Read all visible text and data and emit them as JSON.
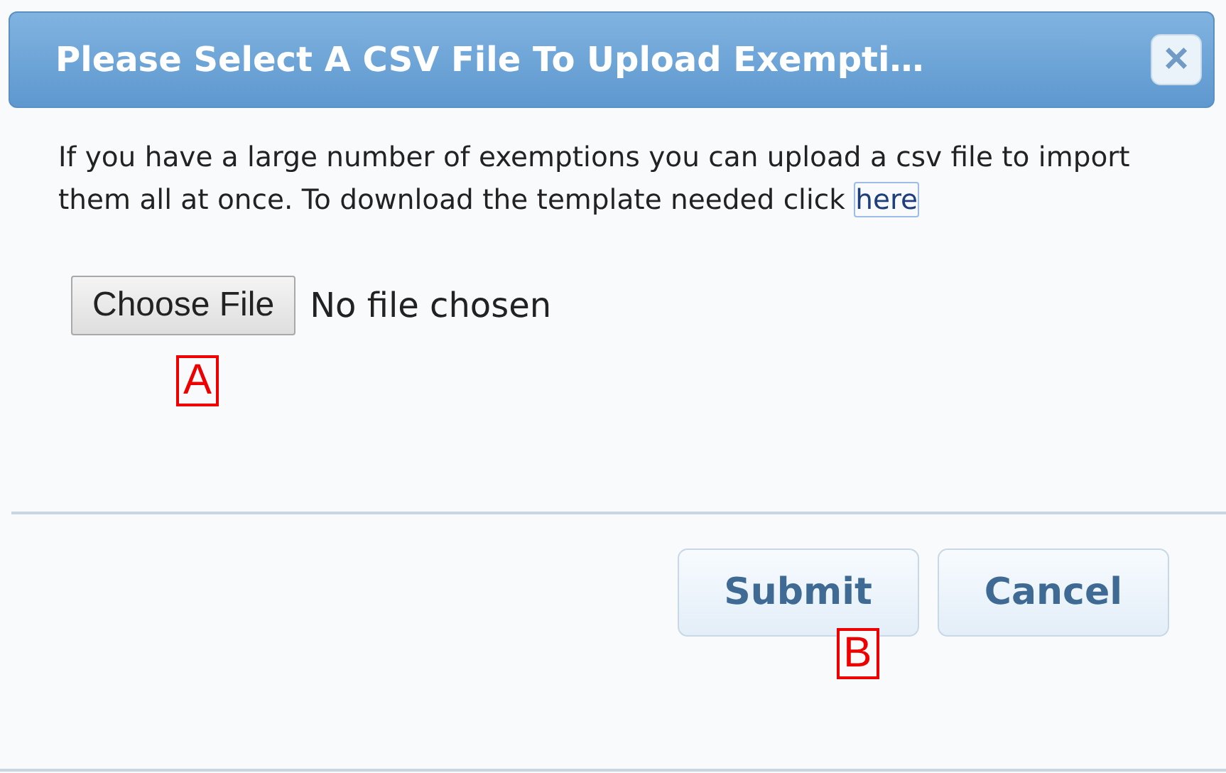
{
  "dialog": {
    "title": "Please Select A CSV File To Upload Exempti…",
    "close": "×"
  },
  "intro": {
    "text": "If you have a large number of exemptions you can upload a csv file to import them all at once. To download the template needed click ",
    "link": "here"
  },
  "file_input": {
    "button": "Choose File",
    "status": "No file chosen",
    "callout": "A"
  },
  "buttons": [
    {
      "label": "Submit",
      "callout": "B"
    },
    {
      "label": "Cancel"
    }
  ]
}
